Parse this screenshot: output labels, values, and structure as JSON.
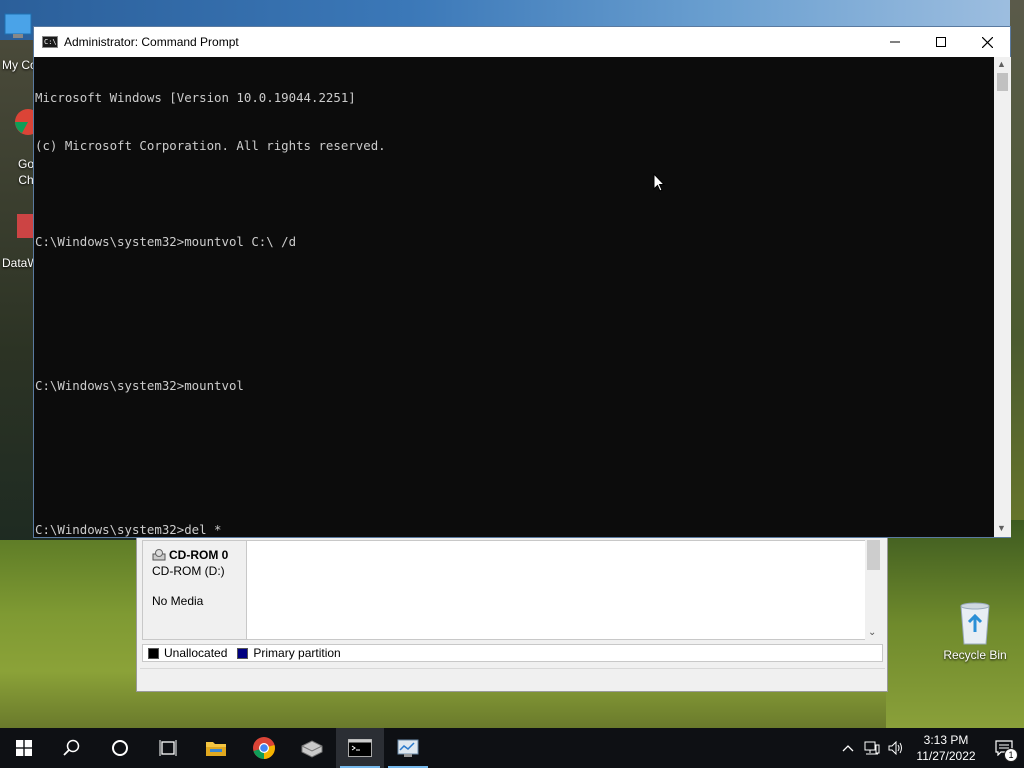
{
  "desktop": {
    "icons": [
      {
        "label": "My Co"
      },
      {
        "label": "Go\nCh"
      },
      {
        "label": "DataW"
      }
    ],
    "recycle_bin": {
      "label": "Recycle Bin"
    }
  },
  "cmd_window": {
    "title": "Administrator: Command Prompt",
    "icon_glyph": "C:\\",
    "controls": {
      "minimize": "—",
      "maximize": "☐",
      "close": "✕"
    },
    "lines": [
      "Microsoft Windows [Version 10.0.19044.2251]",
      "(c) Microsoft Corporation. All rights reserved.",
      "",
      "C:\\Windows\\system32>mountvol C:\\ /d",
      "",
      "",
      "C:\\Windows\\system32>mountvol",
      "",
      "",
      "C:\\Windows\\system32>del *"
    ]
  },
  "disk_management": {
    "disk_name": "CD-ROM 0",
    "disk_type": "CD-ROM (D:)",
    "media": "No Media",
    "legend": [
      {
        "label": "Unallocated",
        "color": "#000000"
      },
      {
        "label": "Primary partition",
        "color": "#000080"
      }
    ]
  },
  "taskbar": {
    "apps": [
      {
        "name": "start",
        "icon": "windows-logo"
      },
      {
        "name": "search",
        "icon": "search-icon"
      },
      {
        "name": "cortana",
        "icon": "cortana-circle"
      },
      {
        "name": "task-view",
        "icon": "task-view-icon"
      },
      {
        "name": "file-explorer",
        "icon": "folder-icon"
      },
      {
        "name": "chrome",
        "icon": "chrome-icon"
      },
      {
        "name": "disk-tool",
        "icon": "disk-icon"
      },
      {
        "name": "command-prompt",
        "icon": "cmd-icon"
      },
      {
        "name": "disk-management",
        "icon": "diskmgmt-icon"
      }
    ],
    "clock": {
      "time": "3:13 PM",
      "date": "11/27/2022"
    },
    "notification_count": "1"
  }
}
